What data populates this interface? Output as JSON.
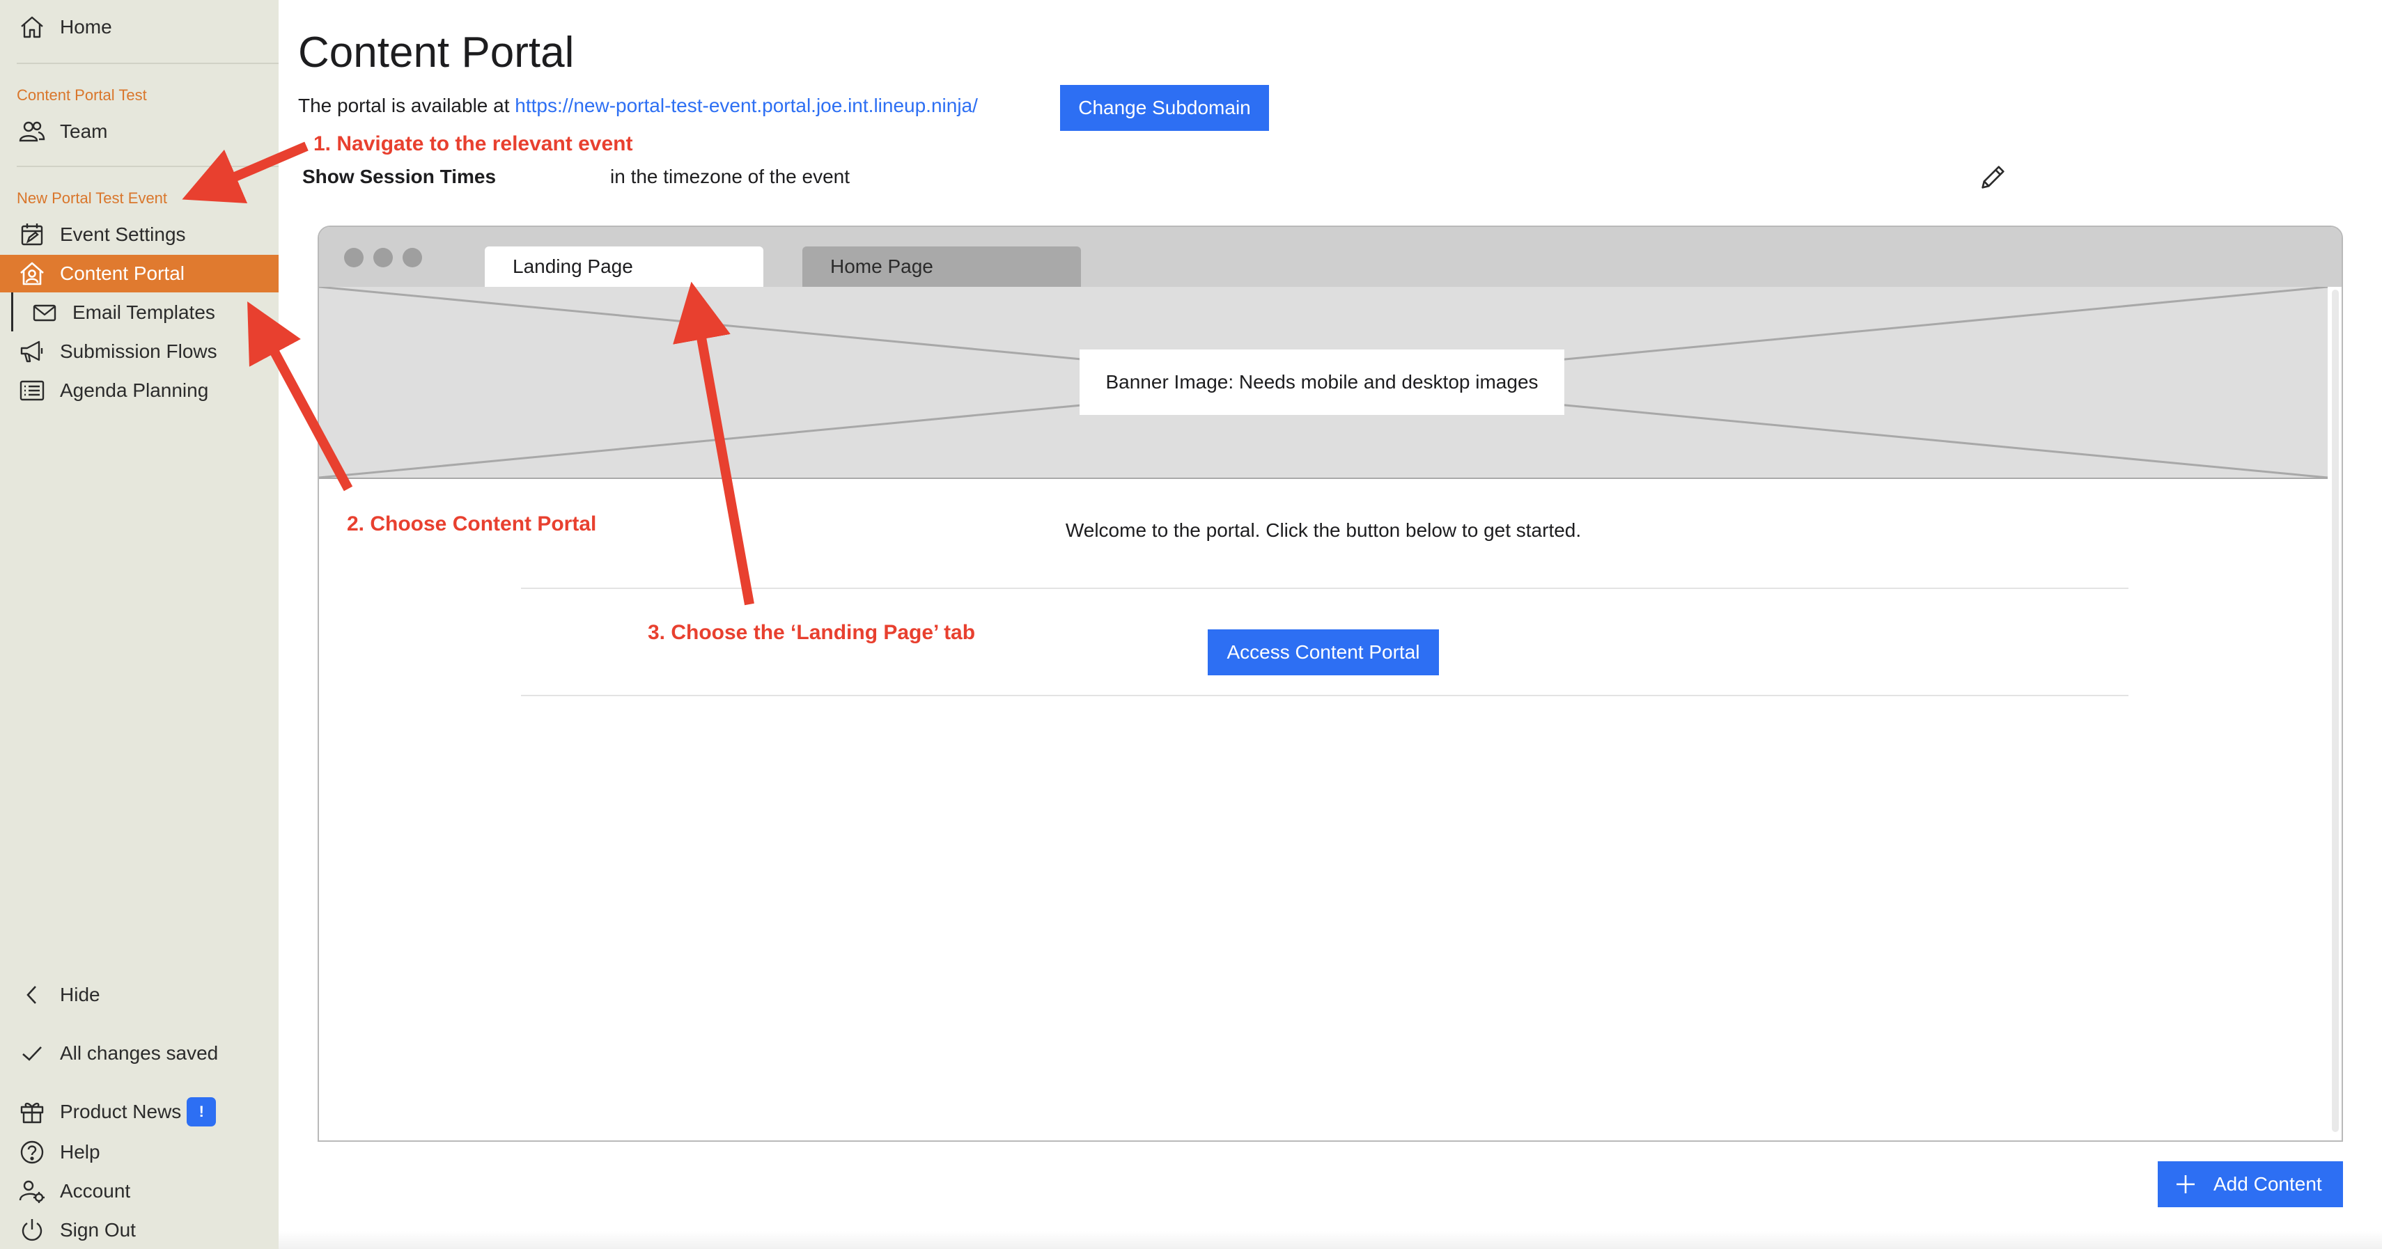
{
  "sidebar": {
    "home_label": "Home",
    "org_section_label": "Content Portal Test",
    "team_label": "Team",
    "event_section_label": "New Portal Test Event",
    "items": [
      {
        "label": "Event Settings",
        "icon": "calendar-edit-icon"
      },
      {
        "label": "Content Portal",
        "icon": "house-user-icon",
        "active": true
      },
      {
        "label": "Email Templates",
        "icon": "envelope-icon"
      },
      {
        "label": "Submission Flows",
        "icon": "megaphone-icon"
      },
      {
        "label": "Agenda Planning",
        "icon": "list-icon"
      }
    ],
    "hide_label": "Hide",
    "saved_label": "All changes saved",
    "product_news_label": "Product News",
    "product_news_badge": "!",
    "help_label": "Help",
    "account_label": "Account",
    "sign_out_label": "Sign Out"
  },
  "main": {
    "title": "Content Portal",
    "portal_prefix": "The portal is available at",
    "portal_url": "https://new-portal-test-event.portal.joe.int.lineup.ninja/",
    "change_subdomain_label": "Change Subdomain",
    "session_times_label": "Show Session Times",
    "session_times_value": "in the timezone of the event",
    "add_content_label": "Add Content"
  },
  "mockup": {
    "tabs": [
      {
        "label": "Landing Page",
        "active": true
      },
      {
        "label": "Home Page",
        "active": false
      }
    ],
    "banner_label": "Banner Image: Needs mobile and desktop images",
    "welcome_text": "Welcome to the portal. Click the button below to get started.",
    "access_button_label": "Access Content Portal"
  },
  "annotations": {
    "step1": "1. Navigate to the relevant event",
    "step2": "2. Choose Content Portal",
    "step3": "3. Choose the ‘Landing Page’ tab"
  },
  "colors": {
    "sidebar_bg": "#e6e7dc",
    "active_item": "#e07a2f",
    "section_label": "#d9762b",
    "primary_button": "#2d6ff3",
    "annotation_red": "#e8402f"
  }
}
